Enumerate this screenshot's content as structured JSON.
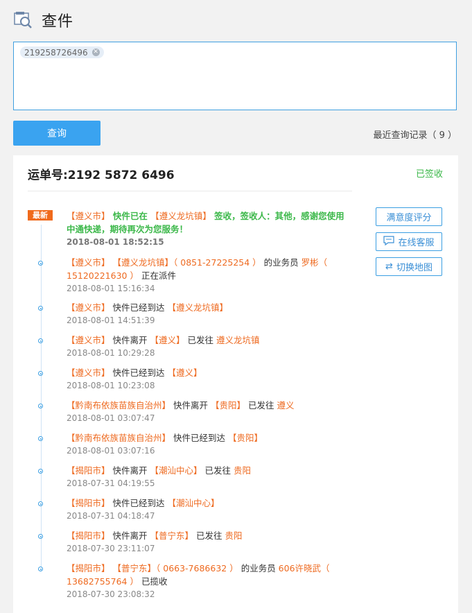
{
  "header": {
    "title": "查件"
  },
  "query": {
    "tag": "219258726496",
    "button": "查询",
    "recent_label": "最近查询记录（ 9 ）"
  },
  "card": {
    "waybill": "运单号:2192 5872 6496",
    "status": "已签收",
    "badge": "最新",
    "side_buttons": [
      "满意度评分",
      "在线客服",
      "切换地图"
    ],
    "events": [
      {
        "segments": [
          [
            "【遵义市】",
            "o"
          ],
          [
            "  快件已在  ",
            "g"
          ],
          [
            "【遵义龙坑镇】",
            "o"
          ],
          [
            "  签收，签收人：其他，感谢您使用中通快递，期待再次为您服务！",
            "g"
          ]
        ],
        "time": "2018-08-01 18:52:15"
      },
      {
        "segments": [
          [
            "【遵义市】",
            "o"
          ],
          [
            " ",
            "n"
          ],
          [
            "【遵义龙坑镇】",
            "o"
          ],
          [
            "（ 0851-27225254 ）",
            "o"
          ],
          [
            " 的业务员 ",
            "n"
          ],
          [
            "罗彬",
            "o"
          ],
          [
            "（ 15120221630 ）",
            "o"
          ],
          [
            " 正在派件",
            "n"
          ]
        ],
        "time": "2018-08-01 15:16:34"
      },
      {
        "segments": [
          [
            "【遵义市】",
            "o"
          ],
          [
            " 快件已经到达 ",
            "n"
          ],
          [
            "【遵义龙坑镇】",
            "o"
          ]
        ],
        "time": "2018-08-01 14:51:39"
      },
      {
        "segments": [
          [
            "【遵义市】",
            "o"
          ],
          [
            " 快件离开 ",
            "n"
          ],
          [
            "【遵义】",
            "o"
          ],
          [
            " 已发往 ",
            "n"
          ],
          [
            "遵义龙坑镇",
            "o"
          ]
        ],
        "time": "2018-08-01 10:29:28"
      },
      {
        "segments": [
          [
            "【遵义市】",
            "o"
          ],
          [
            " 快件已经到达 ",
            "n"
          ],
          [
            "【遵义】",
            "o"
          ]
        ],
        "time": "2018-08-01 10:23:08"
      },
      {
        "segments": [
          [
            "【黔南布依族苗族自治州】",
            "o"
          ],
          [
            " 快件离开 ",
            "n"
          ],
          [
            "【贵阳】",
            "o"
          ],
          [
            " 已发往 ",
            "n"
          ],
          [
            "遵义",
            "o"
          ]
        ],
        "time": "2018-08-01 03:07:47"
      },
      {
        "segments": [
          [
            "【黔南布依族苗族自治州】",
            "o"
          ],
          [
            " 快件已经到达 ",
            "n"
          ],
          [
            "【贵阳】",
            "o"
          ]
        ],
        "time": "2018-08-01 03:07:16"
      },
      {
        "segments": [
          [
            "【揭阳市】",
            "o"
          ],
          [
            " 快件离开 ",
            "n"
          ],
          [
            "【潮汕中心】",
            "o"
          ],
          [
            " 已发往 ",
            "n"
          ],
          [
            "贵阳",
            "o"
          ]
        ],
        "time": "2018-07-31 04:19:55"
      },
      {
        "segments": [
          [
            "【揭阳市】",
            "o"
          ],
          [
            " 快件已经到达 ",
            "n"
          ],
          [
            "【潮汕中心】",
            "o"
          ]
        ],
        "time": "2018-07-31 04:18:47"
      },
      {
        "segments": [
          [
            "【揭阳市】",
            "o"
          ],
          [
            " 快件离开 ",
            "n"
          ],
          [
            "【普宁东】",
            "o"
          ],
          [
            " 已发往 ",
            "n"
          ],
          [
            "贵阳",
            "o"
          ]
        ],
        "time": "2018-07-30 23:11:07"
      },
      {
        "segments": [
          [
            "【揭阳市】",
            "o"
          ],
          [
            " ",
            "n"
          ],
          [
            "【普宁东】",
            "o"
          ],
          [
            "（ 0663-7686632 ）",
            "o"
          ],
          [
            " 的业务员 ",
            "n"
          ],
          [
            "606许晓武",
            "o"
          ],
          [
            "（ 13682755764 ）",
            "o"
          ],
          [
            " 已揽收",
            "n"
          ]
        ],
        "time": "2018-07-30 23:08:32"
      }
    ]
  }
}
